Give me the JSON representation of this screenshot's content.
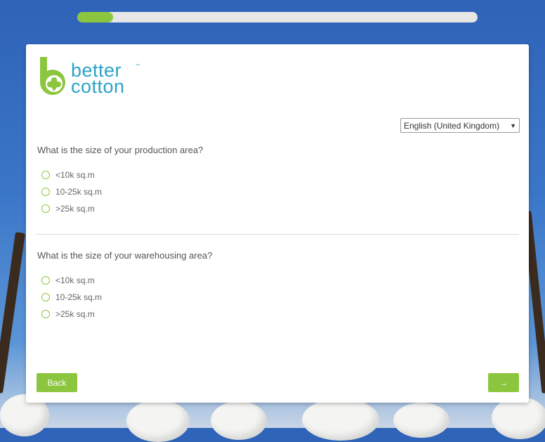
{
  "progress": {
    "percent": 9,
    "fill_color": "#8cc63f"
  },
  "logo": {
    "text_line1": "better",
    "text_line2": "cotton",
    "tm": "™",
    "mark_color": "#8cc63f",
    "text_color": "#2aa3c8"
  },
  "language": {
    "selected": "English (United Kingdom)"
  },
  "questions": [
    {
      "label": "What is the size of your production area?",
      "options": [
        "<10k sq.m",
        "10-25k sq.m",
        ">25k sq.m"
      ]
    },
    {
      "label": "What is the size of your warehousing area?",
      "options": [
        "<10k sq.m",
        "10-25k sq.m",
        ">25k sq.m"
      ]
    }
  ],
  "buttons": {
    "back": "Back",
    "next": "→"
  }
}
